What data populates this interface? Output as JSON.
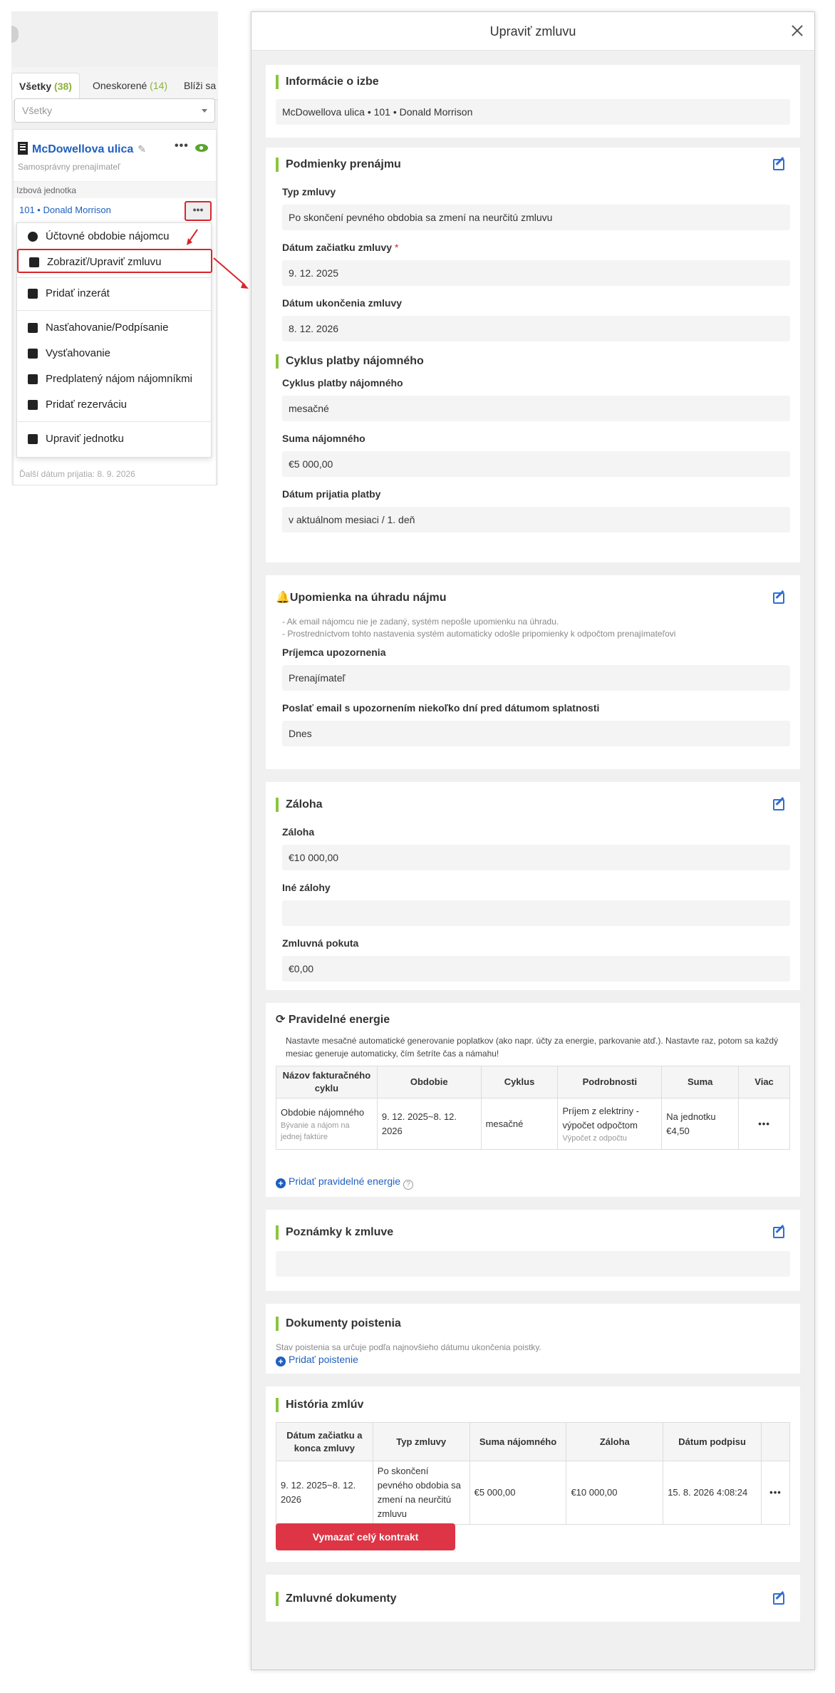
{
  "left": {
    "tabs": [
      {
        "label": "Všetky",
        "count": "(38)"
      },
      {
        "label": "Oneskorené",
        "count": "(14)"
      },
      {
        "label": "Blíži sa",
        "count": ""
      }
    ],
    "filter_value": "Všetky",
    "property": {
      "name": "McDowellova ulica",
      "subtitle": "Samosprávny prenajímateľ",
      "section_label": "Izbová jednotka",
      "unit": "101 • Donald Morrison",
      "more": "•••",
      "next_date": "Ďalší dátum prijatia: 8. 9. 2026"
    },
    "menu": [
      {
        "label": "Účtovné obdobie nájomcu",
        "icon": "dollar-icon"
      },
      {
        "label": "Zobraziť/Upraviť zmluvu",
        "icon": "document-icon"
      },
      {
        "label": "Pridať inzerát",
        "icon": "ad-icon"
      },
      {
        "label": "Nasťahovanie/Podpísanie",
        "icon": "pen-icon"
      },
      {
        "label": "Vysťahovanie",
        "icon": "walking-icon"
      },
      {
        "label": "Predplatený nájom nájomníkmi",
        "icon": "prepaid-icon"
      },
      {
        "label": "Pridať rezerváciu",
        "icon": "calendar-icon"
      },
      {
        "label": "Upraviť jednotku",
        "icon": "edit-icon"
      }
    ]
  },
  "drawer": {
    "title": "Upraviť zmluvu",
    "room_info": {
      "heading": "Informácie o izbe",
      "value": "McDowellova ulica • 101 • Donald Morrison"
    },
    "rental_terms": {
      "heading": "Podmienky prenájmu",
      "contract_type_label": "Typ zmluvy",
      "contract_type_value": "Po skončení pevného obdobia sa zmení na neurčitú zmluvu",
      "start_label": "Dátum začiatku zmluvy",
      "start_required": "*",
      "start_value": "9. 12. 2025",
      "end_label": "Dátum ukončenia zmluvy",
      "end_value": "8. 12. 2026",
      "cycle_heading": "Cyklus platby nájomného",
      "cycle_label": "Cyklus platby nájomného",
      "cycle_value": "mesačné",
      "rent_label": "Suma nájomného",
      "rent_value": "€5 000,00",
      "receipt_label": "Dátum prijatia platby",
      "receipt_value": "v aktuálnom mesiaci / 1. deň"
    },
    "reminder": {
      "heading": "Upomienka na úhradu nájmu",
      "note1": "- Ak email nájomcu nie je zadaný, systém nepošle upomienku na úhradu.",
      "note2": "- Prostredníctvom tohto nastavenia systém automaticky odošle pripomienky k odpočtom prenajímateľovi",
      "recipient_label": "Príjemca upozornenia",
      "recipient_value": "Prenajímateľ",
      "days_label": "Poslať email s upozornením niekoľko dní pred dátumom splatnosti",
      "days_value": "Dnes"
    },
    "deposit": {
      "heading": "Záloha",
      "deposit_label": "Záloha",
      "deposit_value": "€10 000,00",
      "other_label": "Iné zálohy",
      "other_value": "",
      "penalty_label": "Zmluvná pokuta",
      "penalty_value": "€0,00"
    },
    "utilities": {
      "heading": "Pravidelné energie",
      "description": "Nastavte mesačné automatické generovanie poplatkov (ako napr. účty za energie, parkovanie atď.). Nastavte raz, potom sa každý mesiac generuje automaticky, čím šetríte čas a námahu!",
      "columns": [
        "Názov fakturačného cyklu",
        "Obdobie",
        "Cyklus",
        "Podrobnosti",
        "Suma",
        "Viac"
      ],
      "rows": [
        {
          "name": "Obdobie nájomného",
          "name_sub": "Bývanie a nájom na jednej faktúre",
          "period": "9. 12. 2025~8. 12. 2026",
          "cycle": "mesačné",
          "details": "Príjem z elektriny - výpočet odpočtom",
          "details_sub": "Výpočet z odpočtu",
          "amount": "Na jednotku €4,50",
          "more": "•••"
        }
      ],
      "add_link": "Pridať pravidelné energie"
    },
    "notes": {
      "heading": "Poznámky k zmluve",
      "value": ""
    },
    "insurance": {
      "heading": "Dokumenty poistenia",
      "note": "Stav poistenia sa určuje podľa najnovšieho dátumu ukončenia poistky.",
      "add_link": "Pridať poistenie"
    },
    "history": {
      "heading": "História zmlúv",
      "columns": [
        "Dátum začiatku a konca zmluvy",
        "Typ zmluvy",
        "Suma nájomného",
        "Záloha",
        "Dátum podpisu",
        ""
      ],
      "rows": [
        {
          "dates": "9. 12. 2025~8. 12. 2026",
          "type": "Po skončení pevného obdobia sa zmení na neurčitú zmluvu",
          "rent": "€5 000,00",
          "deposit": "€10 000,00",
          "signed": "15. 8. 2026 4:08:24",
          "more": "•••"
        }
      ],
      "delete_button": "Vymazať celý kontrakt"
    },
    "documents": {
      "heading": "Zmluvné dokumenty"
    }
  },
  "colors": {
    "accent_green": "#8cc540",
    "link_blue": "#2060c0",
    "danger_red": "#dd3545",
    "highlight_red": "#d9262c"
  }
}
